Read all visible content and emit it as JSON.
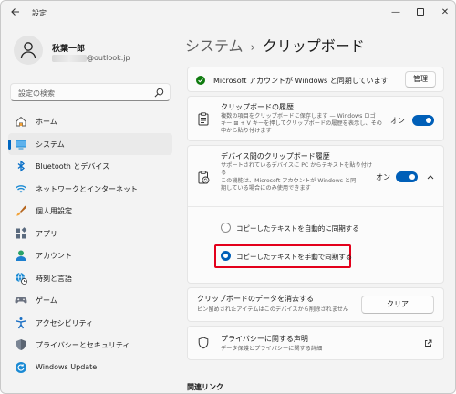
{
  "window": {
    "title": "設定",
    "back_icon": "back-arrow-icon",
    "minimize_glyph": "—",
    "close_glyph": "✕"
  },
  "profile": {
    "name": "秋葉一郎",
    "email_suffix": "@outlook.jp"
  },
  "search": {
    "placeholder": "設定の検索"
  },
  "nav": {
    "items": [
      {
        "label": "ホーム",
        "icon": "home-icon"
      },
      {
        "label": "システム",
        "icon": "system-icon",
        "active": true
      },
      {
        "label": "Bluetooth とデバイス",
        "icon": "bluetooth-icon"
      },
      {
        "label": "ネットワークとインターネット",
        "icon": "wifi-icon"
      },
      {
        "label": "個人用設定",
        "icon": "brush-icon"
      },
      {
        "label": "アプリ",
        "icon": "apps-icon"
      },
      {
        "label": "アカウント",
        "icon": "account-icon"
      },
      {
        "label": "時刻と言語",
        "icon": "globe-clock-icon"
      },
      {
        "label": "ゲーム",
        "icon": "gamepad-icon"
      },
      {
        "label": "アクセシビリティ",
        "icon": "accessibility-icon"
      },
      {
        "label": "プライバシーとセキュリティ",
        "icon": "shield-icon"
      },
      {
        "label": "Windows Update",
        "icon": "update-icon"
      }
    ]
  },
  "breadcrumb": {
    "parent": "システム",
    "separator": "›",
    "current": "クリップボード"
  },
  "sync_banner": {
    "text": "Microsoft アカウントが Windows と同期しています",
    "button": "管理"
  },
  "history": {
    "title": "クリップボードの履歴",
    "desc1": "複数の項目をクリップボードに保存します — Windows ロゴ",
    "desc2": "キー ⊞ + V キーを押してクリップボードの履歴を表示し、その",
    "desc3": "中から貼り付けます",
    "toggle_label": "オン"
  },
  "cross_device": {
    "title": "デバイス間のクリップボード履歴",
    "desc1": "サポートされているデバイスに PC からテキストを貼り付け",
    "desc2": "る",
    "desc3": "この機能は、Microsoft アカウントが Windows と同",
    "desc4": "期している場合にのみ使用できます",
    "toggle_label": "オン",
    "option_auto": "コピーしたテキストを自動的に同期する",
    "option_manual": "コピーしたテキストを手動で同期する"
  },
  "clear": {
    "title": "クリップボードのデータを消去する",
    "desc": "ピン留めされたアイテムはこのデバイスから削除されません",
    "button": "クリア"
  },
  "privacy": {
    "title": "プライバシーに関する声明",
    "desc": "データ保護とプライバシーに関する詳細"
  },
  "related": {
    "heading": "関連リンク"
  },
  "colors": {
    "accent": "#005fb8",
    "highlight": "#e3001b",
    "success": "#0f7b0f"
  }
}
